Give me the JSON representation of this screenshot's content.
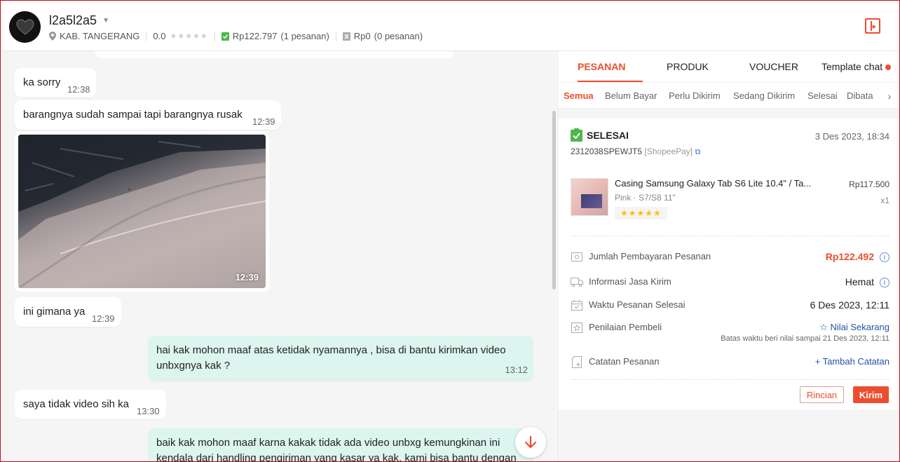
{
  "header": {
    "username": "l2a5l2a5",
    "location": "KAB. TANGERANG",
    "rating": "0.0",
    "paid_amount": "Rp122.797",
    "paid_count": "(1 pesanan)",
    "unpaid_amount": "Rp0",
    "unpaid_count": "(0 pesanan)"
  },
  "chat": {
    "messages": [
      {
        "dir": "in",
        "text": "ka sorry",
        "time": "12:38"
      },
      {
        "dir": "in",
        "text": "barangnya sudah sampai tapi barangnya rusak",
        "time": "12:39"
      },
      {
        "dir": "in",
        "type": "image",
        "time": "12:39"
      },
      {
        "dir": "in",
        "text": "ini gimana ya",
        "time": "12:39"
      },
      {
        "dir": "out",
        "text": "hai kak mohon maaf atas ketidak nyamannya , bisa di bantu kirimkan video unbxgnya kak ?",
        "time": "13:12"
      },
      {
        "dir": "in",
        "text": "saya tidak video sih ka",
        "time": "13:30"
      },
      {
        "dir": "out",
        "text": "baik kak mohon maaf karna kakak tidak ada video unbxg kemungkinan ini kendala dari handling pengiriman yang kasar ya kak, kami bisa bantu dengan",
        "time": ""
      }
    ]
  },
  "panel": {
    "tabs": [
      "PESANAN",
      "PRODUK",
      "VOUCHER",
      "Template chat"
    ],
    "subtabs": [
      "Semua",
      "Belum Bayar",
      "Perlu Dikirim",
      "Sedang Dikirim",
      "Selesai",
      "Dibata"
    ],
    "order": {
      "status": "SELESAI",
      "date": "3 Des 2023, 18:34",
      "order_id": "2312038SPEWJT5",
      "payment": "[ShopeePay]",
      "product_name": "Casing Samsung Galaxy Tab S6 Lite 10.4\" / Ta...",
      "product_variant": "Pink · S7/S8 11\"",
      "product_price": "Rp117.500",
      "product_qty": "x1",
      "stars": "★★★★★",
      "rows": {
        "payment_label": "Jumlah Pembayaran Pesanan",
        "payment_value": "Rp122.492",
        "shipping_label": "Informasi Jasa Kirim",
        "shipping_value": "Hemat",
        "done_label": "Waktu Pesanan Selesai",
        "done_value": "6 Des 2023, 12:11",
        "review_label": "Penilaian Pembeli",
        "review_value": "☆ Nilai Sekarang",
        "review_deadline": "Batas waktu beri nilai sampai 21 Des 2023, 12:11",
        "note_label": "Catatan Pesanan",
        "note_value": "+ Tambah Catatan"
      },
      "btn_detail": "Rincian",
      "btn_send": "Kirim"
    }
  },
  "colors": {
    "accent": "#ee4d2d",
    "outgoing_bubble": "#dcf5ee",
    "link": "#2452a6"
  }
}
